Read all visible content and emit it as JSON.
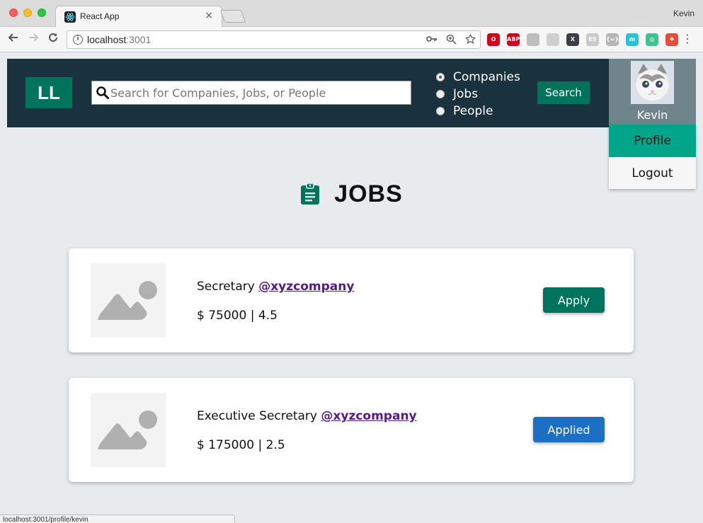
{
  "browser": {
    "tab_title": "React App",
    "tab_close": "×",
    "profile_name": "Kevin",
    "url_host": "localhost",
    "url_port": ":3001",
    "status_url": "localhost:3001/profile/kevin",
    "extensions": [
      {
        "name": "opera-icon",
        "label": "O",
        "color": "#d7001b"
      },
      {
        "name": "adblock-icon",
        "label": "ABP",
        "color": "#d0021b"
      },
      {
        "name": "cube-icon",
        "label": "",
        "color": "#bdbdbd"
      },
      {
        "name": "download-icon",
        "label": "",
        "color": "#cfcfcf"
      },
      {
        "name": "x-extension-icon",
        "label": "X",
        "color": "#3a3f47"
      },
      {
        "name": "es-extension-icon",
        "label": "ES",
        "color": "#c9c9c9"
      },
      {
        "name": "json-extension-icon",
        "label": "{=}",
        "color": "#b5b5b5"
      },
      {
        "name": "m-extension-icon",
        "label": "m",
        "color": "#27c4d6"
      },
      {
        "name": "target-extension-icon",
        "label": "◎",
        "color": "#3fc38d"
      },
      {
        "name": "puzzle-extension-icon",
        "label": "✚",
        "color": "#e44d3a"
      }
    ]
  },
  "navbar": {
    "logo": "LL",
    "search_placeholder": "Search for Companies, Jobs, or People",
    "radio_options": [
      "Companies",
      "Jobs",
      "People"
    ],
    "selected_option": "Companies",
    "search_button": "Search"
  },
  "profile": {
    "name": "Kevin",
    "menu": [
      "Profile",
      "Logout"
    ]
  },
  "main": {
    "heading": "JOBS"
  },
  "jobs": [
    {
      "title": "Secretary",
      "company": "@xyzcompany",
      "salary": "$ 75000",
      "equity": "4.5",
      "button": "Apply"
    },
    {
      "title": "Executive Secretary",
      "company": "@xyzcompany",
      "salary": "$ 175000",
      "equity": "2.5",
      "button": "Applied"
    }
  ],
  "colors": {
    "navbar_bg": "#19323d",
    "brand_green": "#00735d",
    "dropdown_active": "#00a58a",
    "applied_blue": "#1b70c6",
    "company_link": "#551a8b"
  }
}
